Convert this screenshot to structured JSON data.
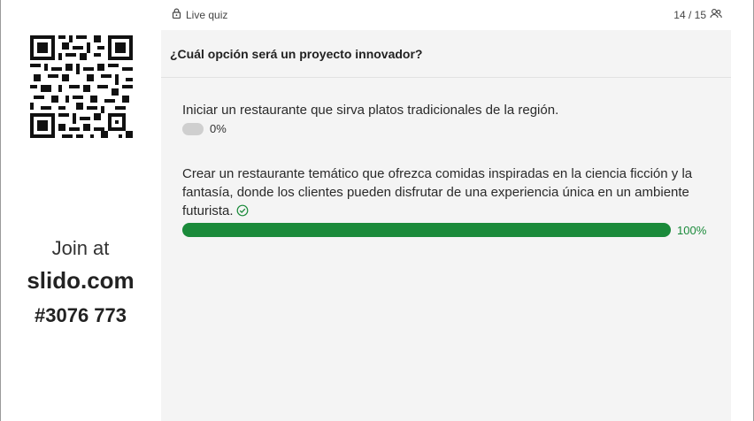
{
  "header": {
    "live_label": "Live quiz",
    "participants": "14 / 15",
    "lock_icon": "lock-icon",
    "people_icon": "people-icon"
  },
  "join": {
    "label": "Join at",
    "domain": "slido.com",
    "code": "#3076 773",
    "qr_icon": "qr-code"
  },
  "quiz": {
    "question": "¿Cuál opción será un proyecto innovador?",
    "options": [
      {
        "text": "Iniciar un restaurante que sirva platos tradicionales de la región.",
        "percent_label": "0%",
        "fraction": 0,
        "correct": false
      },
      {
        "text": "Crear un restaurante temático que ofrezca comidas inspiradas en la ciencia ficción y la fantasía, donde los clientes pueden disfrutar de una experiencia única en un ambiente futurista.",
        "percent_label": "100%",
        "fraction": 1,
        "correct": true
      }
    ]
  },
  "colors": {
    "accent_green": "#1a8a3a",
    "card_bg": "#f4f4f4",
    "empty_bar": "#cfcfcf"
  }
}
